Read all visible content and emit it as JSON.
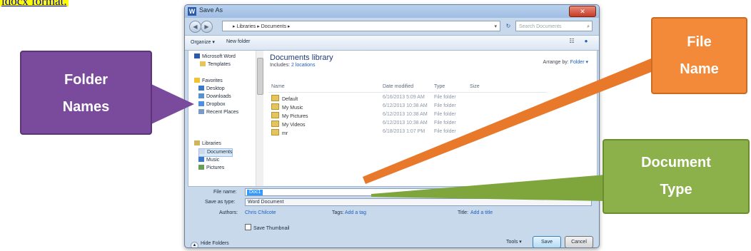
{
  "caption": "ldocx format.",
  "window": {
    "title": "Save As",
    "app_icon_letter": "W",
    "close": "✕",
    "breadcrumb": "▸ Libraries ▸ Documents ▸",
    "search_placeholder": "Search Documents"
  },
  "toolbar": {
    "organize": "Organize ▾",
    "new_folder": "New folder"
  },
  "nav_pane": {
    "items": [
      {
        "label": "Microsoft Word",
        "icon": "word-icon"
      },
      {
        "label": "Templates",
        "icon": "folder-icon"
      },
      {
        "label": "Favorites",
        "icon": "star-icon"
      },
      {
        "label": "Desktop",
        "icon": "desktop-icon"
      },
      {
        "label": "Downloads",
        "icon": "downloads-icon"
      },
      {
        "label": "Dropbox",
        "icon": "dropbox-icon"
      },
      {
        "label": "Recent Places",
        "icon": "recent-icon"
      },
      {
        "label": "Libraries",
        "icon": "libraries-icon"
      },
      {
        "label": "Documents",
        "icon": "documents-icon"
      },
      {
        "label": "Music",
        "icon": "music-icon"
      },
      {
        "label": "Pictures",
        "icon": "pictures-icon"
      }
    ]
  },
  "library": {
    "title": "Documents library",
    "includes_label": "Includes:",
    "includes_value": "2 locations",
    "arrange_label": "Arrange by:",
    "arrange_value": "Folder ▾"
  },
  "columns": [
    "Name",
    "Date modified",
    "Type",
    "Size"
  ],
  "files": [
    {
      "name": "Default",
      "date": "6/16/2013 5:09 AM",
      "type": "File folder"
    },
    {
      "name": "My Music",
      "date": "6/12/2013 10:38 AM",
      "type": "File folder"
    },
    {
      "name": "My Pictures",
      "date": "6/12/2013 10:38 AM",
      "type": "File folder"
    },
    {
      "name": "My Videos",
      "date": "6/12/2013 10:38 AM",
      "type": "File folder"
    },
    {
      "name": "mr",
      "date": "6/18/2013 1:07 PM",
      "type": "File folder"
    }
  ],
  "form": {
    "file_name_label": "File name:",
    "file_name_value": "Doc1",
    "save_type_label": "Save as type:",
    "save_type_value": "Word Document",
    "authors_label": "Authors:",
    "authors_value": "Chris Chilcote",
    "tags_label": "Tags:",
    "tags_value": "Add a tag",
    "title_label": "Title:",
    "title_value": "Add a title",
    "thumbnail_label": "Save Thumbnail",
    "hide_folders": "Hide Folders",
    "tools": "Tools ▾",
    "save": "Save",
    "cancel": "Cancel"
  },
  "callouts": {
    "folder_names": [
      "Folder",
      "Names"
    ],
    "file_name": [
      "File",
      "Name"
    ],
    "document_type": [
      "Document",
      "Type"
    ]
  },
  "colors": {
    "folder_callout": "#7a4a9c",
    "file_callout": "#f28a3a",
    "type_callout": "#8db14a",
    "accent": "#1c5fbf"
  }
}
